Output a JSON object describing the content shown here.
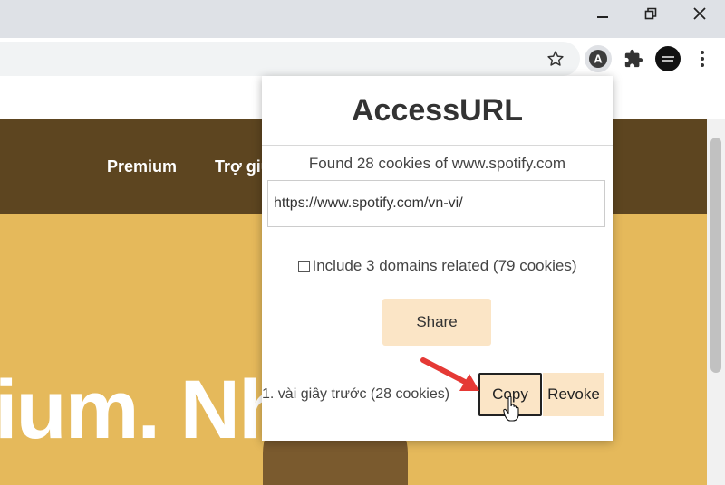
{
  "browser": {
    "window_controls": [
      "minimize-icon",
      "restore-icon",
      "close-icon"
    ],
    "toolbar_icons": [
      "star-icon",
      "accessurl-extension-icon",
      "puzzle-icon",
      "avatar",
      "kebab-menu-icon"
    ],
    "extension_letter": "A"
  },
  "page": {
    "nav_links": [
      "Premium",
      "Trợ giú"
    ],
    "hero_text": "ium. Nh"
  },
  "popup": {
    "title": "AccessURL",
    "found_text": "Found 28 cookies of www.spotify.com",
    "url_value": "https://www.spotify.com/vn-vi/",
    "include_label": "Include 3 domains related (79 cookies)",
    "include_checked": false,
    "share_label": "Share",
    "history": [
      {
        "text": "1. vài giây trước (28 cookies)",
        "copy_label": "Copy",
        "revoke_label": "Revoke"
      }
    ]
  },
  "colors": {
    "nav_bg": "#5d4520",
    "hero_bg": "#e5b95b",
    "button_bg": "#fbe5c6",
    "arrow": "#e53935"
  }
}
